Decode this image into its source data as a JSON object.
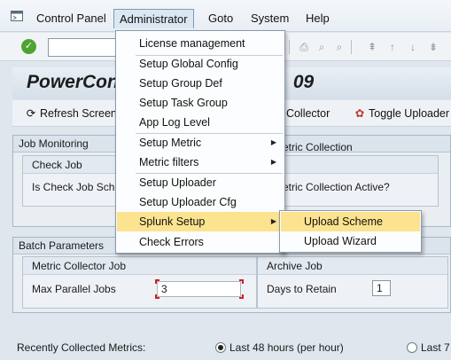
{
  "menubar": {
    "items": [
      "Control Panel",
      "Administrator",
      "Goto",
      "System",
      "Help"
    ],
    "active": "Administrator"
  },
  "toolbar": {
    "ok_icon": "check-icon",
    "command_field": ""
  },
  "title": "PowerCon",
  "title_suffix": "09",
  "app_toolbar": {
    "refresh_label": "Refresh Screen",
    "collector_label": "t Collector",
    "toggle_label": "Toggle Uploader"
  },
  "job_monitoring": {
    "title": "Job Monitoring",
    "check_job": {
      "header": "Check Job",
      "field_label": "Is Check Job Sch"
    },
    "metric_collection": {
      "header": "etric Collection",
      "field_label": "etric Collection Active?"
    }
  },
  "batch_parameters": {
    "title": "Batch Parameters",
    "metric_collector_job": {
      "header": "Metric Collector Job",
      "field_label": "Max Parallel Jobs",
      "value": "3"
    },
    "archive_job": {
      "header": "Archive Job",
      "field_label": "Days to Retain",
      "value": "1"
    }
  },
  "recently_collected": {
    "label": "Recently Collected Metrics:",
    "option1": "Last 48 hours (per hour)",
    "option2": "Last 7"
  },
  "dropdown": {
    "items": [
      {
        "label": "License management"
      },
      {
        "label": "Setup Global Config"
      },
      {
        "label": "Setup Group Def"
      },
      {
        "label": "Setup Task Group"
      },
      {
        "label": "App Log Level"
      },
      {
        "label": "Setup Metric"
      },
      {
        "label": "Metric filters"
      },
      {
        "label": "Setup Uploader"
      },
      {
        "label": "Setup Uploader Cfg"
      },
      {
        "label": "Splunk Setup"
      },
      {
        "label": "Check Errors"
      }
    ],
    "highlighted": "Splunk Setup"
  },
  "submenu": {
    "items": [
      {
        "label": "Upload Scheme"
      },
      {
        "label": "Upload Wizard"
      }
    ],
    "highlighted": "Upload Scheme"
  },
  "colors": {
    "highlight": "#fbe38f",
    "ok_green": "#4da431",
    "focus_corner": "#d02020"
  }
}
